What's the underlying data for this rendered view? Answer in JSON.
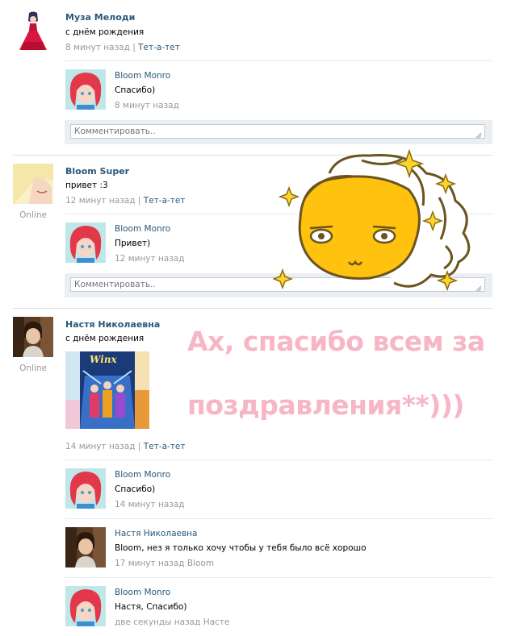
{
  "posts": [
    {
      "author": "Муза Мелоди",
      "text": "с днём рождения",
      "time": "8 минут назад",
      "link": "Тет-а-тет",
      "replies": [
        {
          "author": "Bloom Monro",
          "text": "Спасибо)",
          "time": "8 минут назад"
        }
      ],
      "comment_placeholder": "Комментировать.."
    },
    {
      "author": "Bloom Super",
      "status": "Online",
      "text": "привет :3",
      "time": "12 минут назад",
      "link": "Тет-а-тет",
      "replies": [
        {
          "author": "Bloom Monro",
          "text": "Привет)",
          "time": "12 минут назад"
        }
      ],
      "comment_placeholder": "Комментировать.."
    },
    {
      "author": "Настя Николаевна",
      "status": "Online",
      "text": "с днём рождения",
      "time": "14 минут назад",
      "link": "Тет-а-тет",
      "replies": [
        {
          "author": "Bloom Monro",
          "text": "Спасибо)",
          "time": "14 минут назад"
        },
        {
          "author": "Настя Николаевна",
          "text": "Bloom, нез я только хочу чтобы у тебя было всё хорошо",
          "time": "17 минут назад Bloom"
        },
        {
          "author": "Bloom Monro",
          "text": "Настя, Спасибо)",
          "time": "две секунды назад Насте"
        }
      ]
    }
  ],
  "overlay": {
    "line1": "Ах, спасибо всем за",
    "line2": "поздравления**)))"
  },
  "colors": {
    "link": "#2b587a",
    "meta": "#999999",
    "overlay_pink": "#f7b6c7",
    "comment_bg": "#eceff2"
  }
}
